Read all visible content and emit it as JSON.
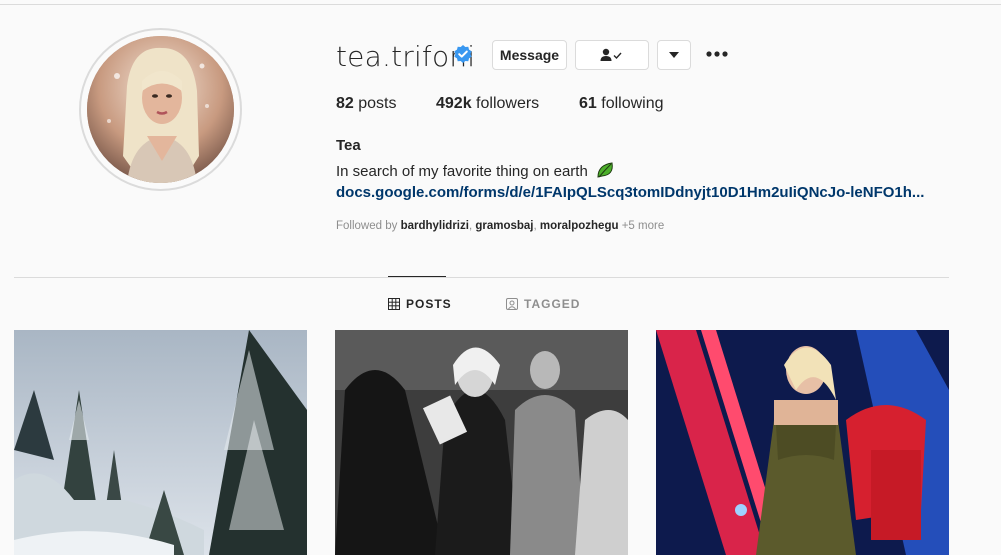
{
  "profile": {
    "username": "tea.trifoni",
    "verified": true,
    "avatar": "profile-photo"
  },
  "actions": {
    "message_label": "Message",
    "follow_icon": "person-check-icon",
    "dropdown_icon": "caret-down-icon",
    "more_icon": "ellipsis-icon"
  },
  "stats": {
    "posts_count": "82",
    "posts_label": "posts",
    "followers_count": "492k",
    "followers_label": "followers",
    "following_count": "61",
    "following_label": "following"
  },
  "bio": {
    "name": "Tea",
    "text": "In search of my favorite thing on earth",
    "emoji": "leaf-icon",
    "link": "docs.google.com/forms/d/e/1FAIpQLScq3tomIDdnyjt10D1Hm2uIiQNcJo-leNFO1h...",
    "followed_by_prefix": "Followed by",
    "followed_by_users": [
      "bardhylidrizi",
      "gramosbaj",
      "moralpozhegu"
    ],
    "followed_by_more": "+5 more"
  },
  "tabs": [
    {
      "label": "POSTS",
      "icon": "grid-icon",
      "active": true
    },
    {
      "label": "TAGGED",
      "icon": "tagged-icon",
      "active": false
    }
  ],
  "posts": [
    {
      "description": "snowy-pine-forest"
    },
    {
      "description": "black-and-white-event-photo"
    },
    {
      "description": "woman-in-green-dress-on-stage"
    }
  ],
  "colors": {
    "link": "#00376b",
    "verified": "#3897f0",
    "background": "#fafafa",
    "border": "#dbdbdb"
  }
}
